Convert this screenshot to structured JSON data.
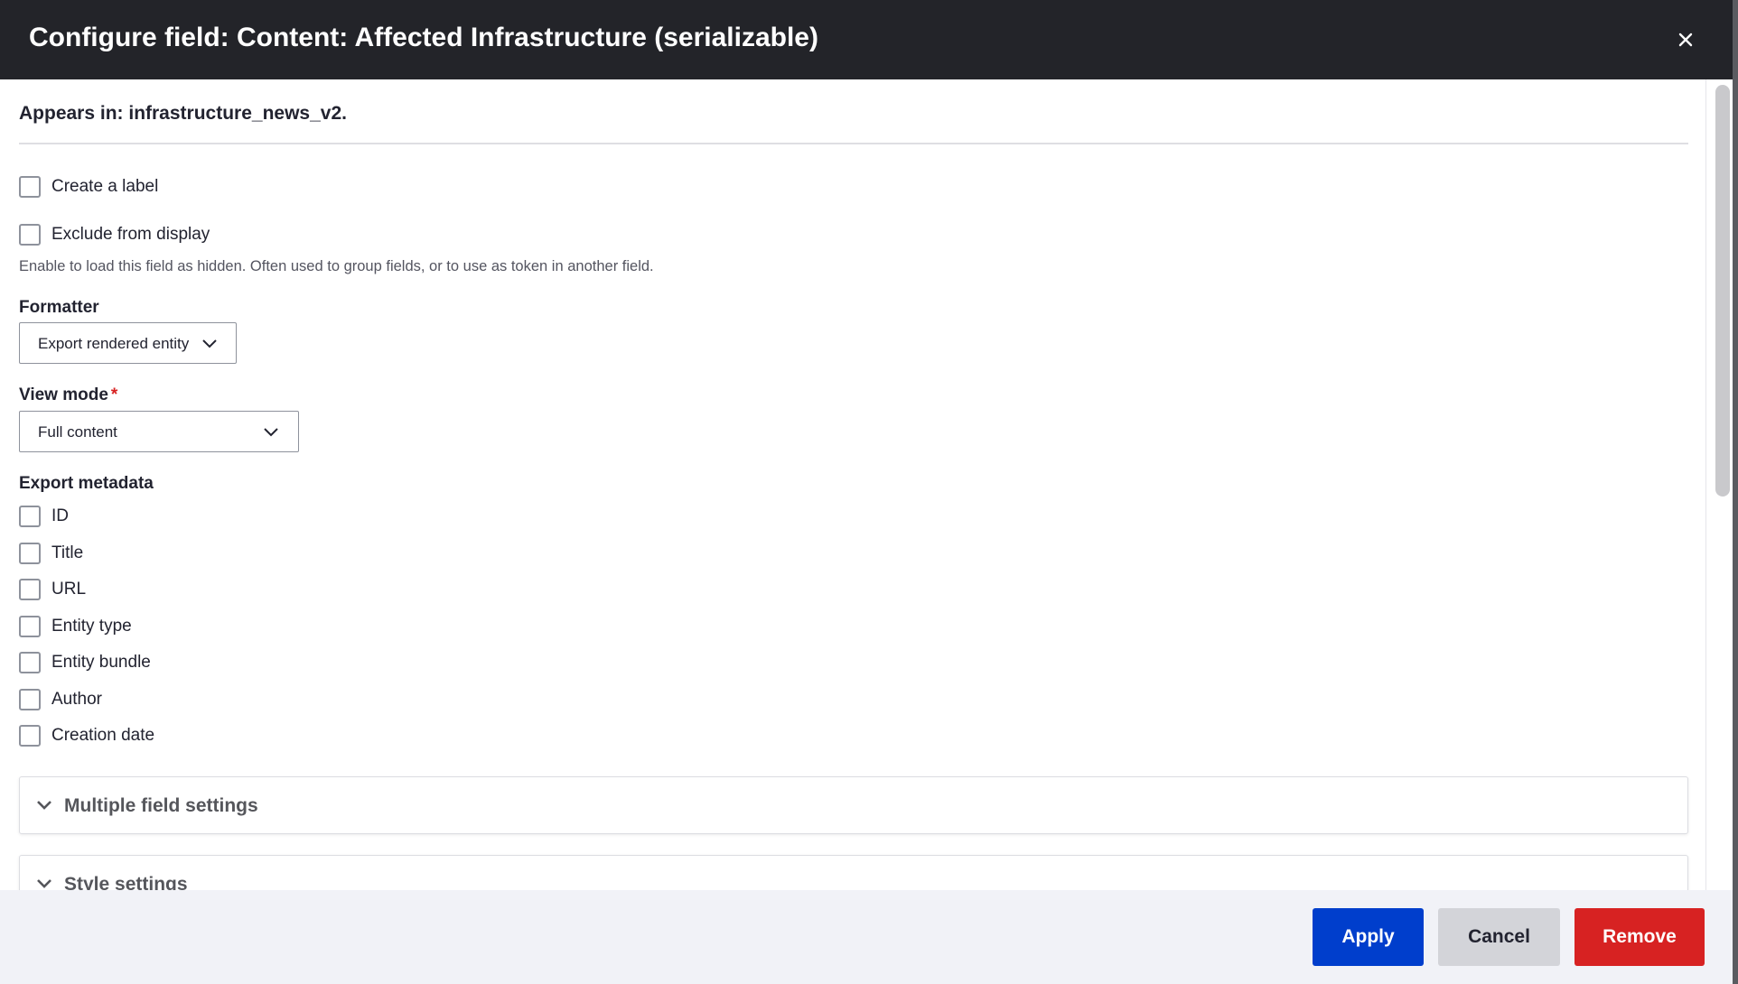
{
  "dialog": {
    "title": "Configure field: Content: Affected Infrastructure (serializable)",
    "close_icon": "close-icon"
  },
  "appears_in": "Appears in: infrastructure_news_v2.",
  "create_label": {
    "label": "Create a label",
    "checked": false
  },
  "exclude_display": {
    "label": "Exclude from display",
    "checked": false,
    "description": "Enable to load this field as hidden. Often used to group fields, or to use as token in another field."
  },
  "formatter": {
    "label": "Formatter",
    "value": "Export rendered entity",
    "icon": "chevron-down-icon"
  },
  "view_mode": {
    "label": "View mode",
    "required_marker": "*",
    "value": "Full content",
    "icon": "chevron-down-icon"
  },
  "export_metadata": {
    "label": "Export metadata",
    "options": [
      {
        "label": "ID",
        "checked": false
      },
      {
        "label": "Title",
        "checked": false
      },
      {
        "label": "URL",
        "checked": false
      },
      {
        "label": "Entity type",
        "checked": false
      },
      {
        "label": "Entity bundle",
        "checked": false
      },
      {
        "label": "Author",
        "checked": false
      },
      {
        "label": "Creation date",
        "checked": false
      }
    ]
  },
  "sections": [
    {
      "label": "Multiple field settings",
      "icon": "chevron-down-icon"
    },
    {
      "label": "Style settings",
      "icon": "chevron-down-icon"
    }
  ],
  "footer": {
    "apply_label": "Apply",
    "cancel_label": "Cancel",
    "remove_label": "Remove"
  },
  "colors": {
    "titlebar": "#232429",
    "primary": "#003ecc",
    "danger": "#d72222",
    "secondary": "#d3d4d9",
    "footer_bg": "#f1f2f7"
  }
}
